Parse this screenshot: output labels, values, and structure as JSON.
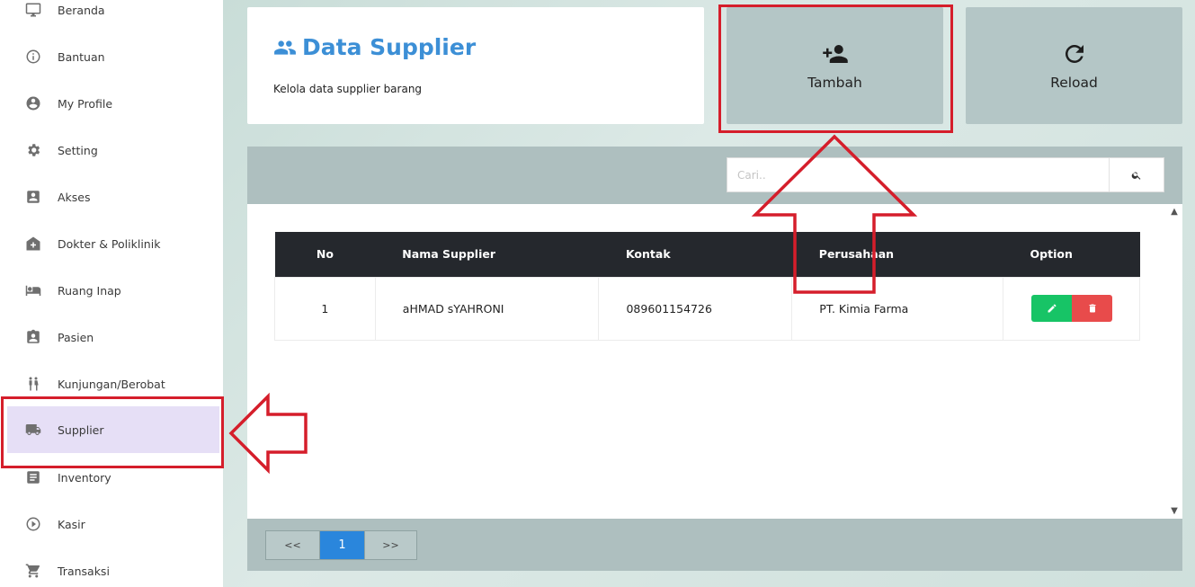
{
  "sidebar": {
    "items": [
      {
        "label": "Beranda",
        "icon": "monitor-icon"
      },
      {
        "label": "Bantuan",
        "icon": "info-icon"
      },
      {
        "label": "My Profile",
        "icon": "account-circle-icon"
      },
      {
        "label": "Setting",
        "icon": "gear-icon"
      },
      {
        "label": "Akses",
        "icon": "contact-card-icon"
      },
      {
        "label": "Dokter & Poliklinik",
        "icon": "hospital-icon"
      },
      {
        "label": "Ruang Inap",
        "icon": "bed-icon"
      },
      {
        "label": "Pasien",
        "icon": "badge-icon"
      },
      {
        "label": "Kunjungan/Berobat",
        "icon": "people-icon"
      },
      {
        "label": "Supplier",
        "icon": "truck-icon"
      },
      {
        "label": "Inventory",
        "icon": "list-icon"
      },
      {
        "label": "Kasir",
        "icon": "play-circle-icon"
      },
      {
        "label": "Transaksi",
        "icon": "cart-icon"
      }
    ],
    "active": "Supplier"
  },
  "header": {
    "title": "Data Supplier",
    "description": "Kelola data supplier barang"
  },
  "actions": {
    "add_label": "Tambah",
    "reload_label": "Reload"
  },
  "search": {
    "placeholder": "Cari.."
  },
  "table": {
    "columns": [
      "No",
      "Nama Supplier",
      "Kontak",
      "Perusahaan",
      "Option"
    ],
    "rows": [
      {
        "no": "1",
        "nama": "aHMAD sYAHRONI",
        "kontak": "089601154726",
        "perusahaan": "PT. Kimia Farma"
      }
    ]
  },
  "pagination": {
    "prev": "<<",
    "current": "1",
    "next": ">>"
  },
  "colors": {
    "accent": "#3c8fd6",
    "edit": "#17c466",
    "delete": "#e84b4b",
    "annotation": "#d51e2b",
    "active_nav": "#e6dff6"
  }
}
